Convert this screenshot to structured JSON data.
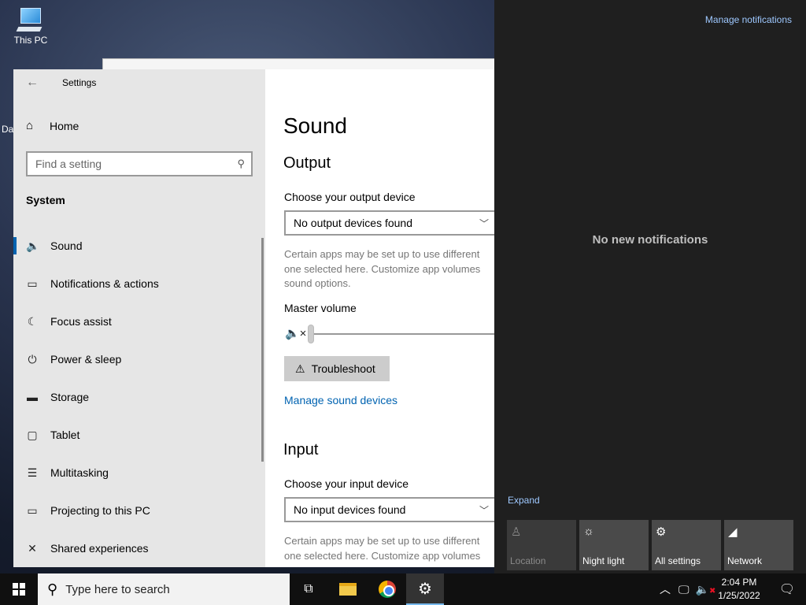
{
  "desktop": {
    "icon_label": "This PC",
    "stub_label": "Da"
  },
  "settings": {
    "window_title": "Settings",
    "home_label": "Home",
    "search_placeholder": "Find a setting",
    "section_label": "System",
    "nav": [
      {
        "label": "Sound",
        "icon": "speaker-icon",
        "glyph": "🔈"
      },
      {
        "label": "Notifications & actions",
        "icon": "notifications-icon",
        "glyph": "▭"
      },
      {
        "label": "Focus assist",
        "icon": "moon-icon",
        "glyph": "☾"
      },
      {
        "label": "Power & sleep",
        "icon": "power-icon",
        "glyph": "⏻"
      },
      {
        "label": "Storage",
        "icon": "storage-icon",
        "glyph": "▬"
      },
      {
        "label": "Tablet",
        "icon": "tablet-icon",
        "glyph": "▢"
      },
      {
        "label": "Multitasking",
        "icon": "multitasking-icon",
        "glyph": "☰"
      },
      {
        "label": "Projecting to this PC",
        "icon": "projecting-icon",
        "glyph": "▭"
      },
      {
        "label": "Shared experiences",
        "icon": "shared-experiences-icon",
        "glyph": "✕"
      }
    ],
    "content": {
      "title": "Sound",
      "output_heading": "Output",
      "output_device_label": "Choose your output device",
      "output_device_value": "No output devices found",
      "output_desc_line1": "Certain apps may be set up to use different",
      "output_desc_line2": "one selected here. Customize app volumes",
      "output_desc_line3": "sound options.",
      "master_volume_label": "Master volume",
      "master_volume_level": 0,
      "troubleshoot_label": "Troubleshoot",
      "manage_devices_link": "Manage sound devices",
      "input_heading": "Input",
      "input_device_label": "Choose your input device",
      "input_device_value": "No input devices found",
      "input_desc_line1": "Certain apps may be set up to use different",
      "input_desc_line2": "one selected here. Customize app volumes"
    }
  },
  "action_center": {
    "manage_notifications": "Manage notifications",
    "empty_message": "No new notifications",
    "expand_label": "Expand",
    "tiles": [
      {
        "label": "Location",
        "icon": "location-icon",
        "glyph": "♙",
        "enabled": false
      },
      {
        "label": "Night light",
        "icon": "night-light-icon",
        "glyph": "☼",
        "enabled": true
      },
      {
        "label": "All settings",
        "icon": "gear-icon",
        "glyph": "⚙",
        "enabled": true
      },
      {
        "label": "Network",
        "icon": "network-icon",
        "glyph": "◢",
        "enabled": true
      }
    ]
  },
  "taskbar": {
    "search_placeholder": "Type here to search",
    "time": "2:04 PM",
    "date": "1/25/2022"
  }
}
